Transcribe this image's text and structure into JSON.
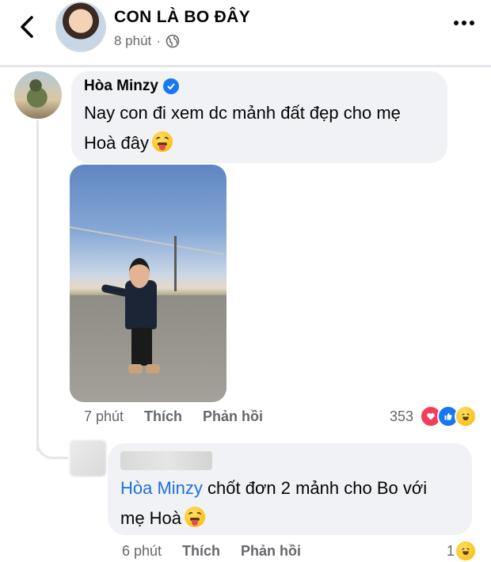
{
  "header": {
    "title": "CON LÀ BO ĐÂY",
    "time": "8 phút",
    "separator": "·",
    "privacy_icon": "globe-icon"
  },
  "comment": {
    "author": "Hòa Minzy",
    "verified": true,
    "text": "Nay con đi xem dc mảnh đất đẹp cho mẹ\nHoà đây",
    "emoji": "squinting-tongue-emoji",
    "time": "7 phút",
    "like_label": "Thích",
    "reply_label": "Phản hồi",
    "reaction_count": "353",
    "reaction_icons": [
      "heart-icon",
      "like-icon",
      "haha-icon"
    ]
  },
  "reply": {
    "mention": "Hòa Minzy",
    "text": " chốt đơn 2 mảnh cho Bo với\nmẹ Hoà",
    "emoji": "squinting-tongue-emoji",
    "time": "6 phút",
    "like_label": "Thích",
    "reply_label": "Phản hồi",
    "reaction_count": "1",
    "reaction_icons": [
      "haha-icon"
    ]
  },
  "colors": {
    "bubble": "#f0f2f5",
    "meta_text": "#65676b",
    "mention": "#216fdb",
    "verified": "#1877f2",
    "heart": "#f33e58",
    "like": "#1877f2"
  }
}
